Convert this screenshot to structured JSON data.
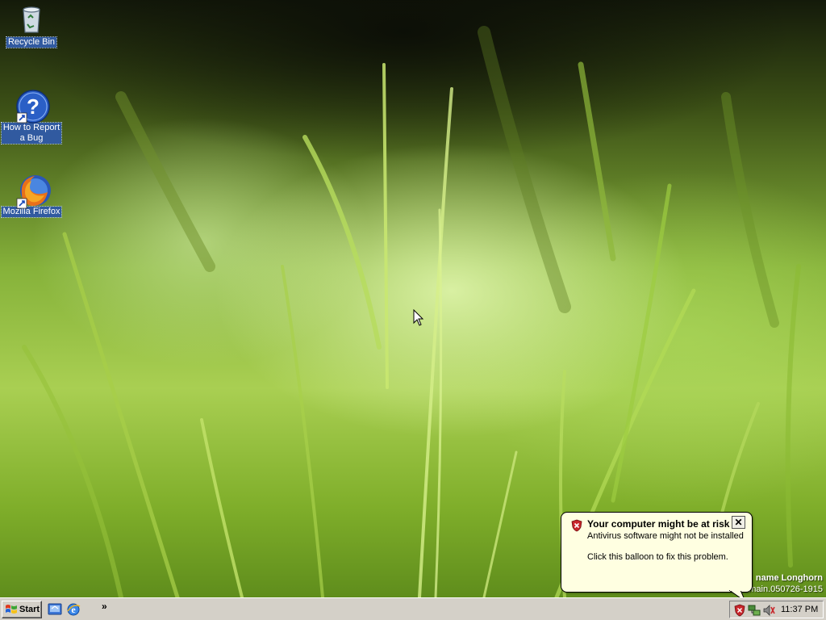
{
  "desktop": {
    "icons": [
      {
        "label": "Recycle Bin",
        "icon": "recycle-bin-icon"
      },
      {
        "label": "How to Report\na Bug",
        "label_line1": "How to Report",
        "label_line2": "a Bug",
        "icon": "help-question-icon"
      },
      {
        "label": "Mozilla Firefox",
        "icon": "firefox-icon"
      }
    ]
  },
  "balloon": {
    "title": "Your computer might be at risk",
    "line1": "Antivirus software might not be installed",
    "line2": "Click this balloon to fix this problem.",
    "close_label": "✕",
    "icon": "security-shield-icon"
  },
  "watermark": {
    "line1": "name Longhorn",
    "line2": "main.050726-1915"
  },
  "taskbar": {
    "start_label": "Start",
    "quicklaunch": [
      {
        "icon": "show-desktop-icon"
      },
      {
        "icon": "internet-explorer-icon"
      }
    ],
    "more_label": "»",
    "tray": {
      "icons": [
        "security-center-icon",
        "network-icon",
        "volume-icon"
      ],
      "clock": "11:37 PM"
    }
  },
  "colors": {
    "selection": "#315aa0",
    "balloon_bg": "#ffffe1",
    "taskbar_bg": "#d4d0c8"
  }
}
